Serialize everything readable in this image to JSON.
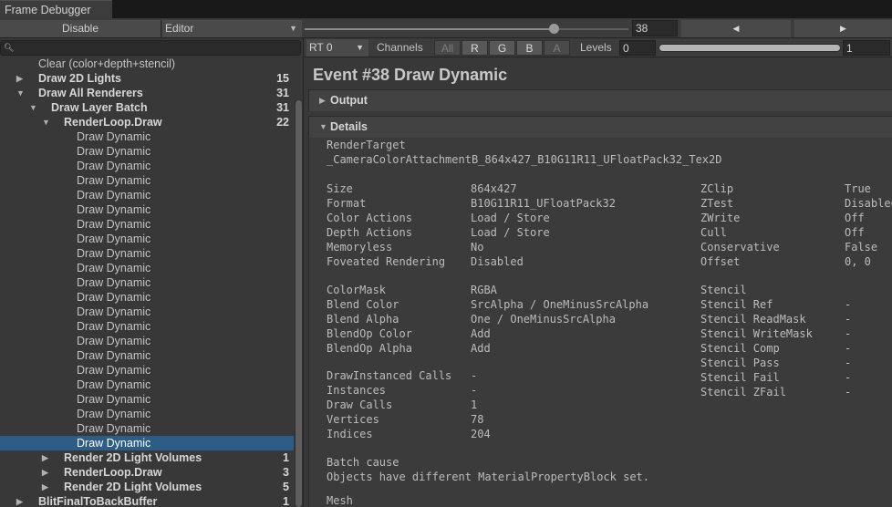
{
  "window": {
    "tab_title": "Frame Debugger"
  },
  "toolbar": {
    "disable_label": "Disable",
    "target_dropdown": "Editor",
    "event_index": "38",
    "slider_fraction": 0.77,
    "prev_icon": "triangle-left-icon",
    "next_icon": "triangle-right-icon"
  },
  "search": {
    "placeholder": "",
    "value": ""
  },
  "tree": [
    {
      "label": "Clear (color+depth+stencil)",
      "level": 0,
      "count": "",
      "bold": false,
      "arrow": "",
      "selected": false
    },
    {
      "label": "Draw 2D Lights",
      "level": 0,
      "count": "15",
      "bold": true,
      "arrow": "right",
      "selected": false
    },
    {
      "label": "Draw All Renderers",
      "level": 0,
      "count": "31",
      "bold": true,
      "arrow": "down",
      "selected": false
    },
    {
      "label": "Draw Layer Batch",
      "level": 1,
      "count": "31",
      "bold": true,
      "arrow": "down",
      "selected": false
    },
    {
      "label": "RenderLoop.Draw",
      "level": 2,
      "count": "22",
      "bold": true,
      "arrow": "down",
      "selected": false
    },
    {
      "label": "Draw Dynamic",
      "level": 3,
      "count": "",
      "bold": false,
      "arrow": "",
      "selected": false
    },
    {
      "label": "Draw Dynamic",
      "level": 3,
      "count": "",
      "bold": false,
      "arrow": "",
      "selected": false
    },
    {
      "label": "Draw Dynamic",
      "level": 3,
      "count": "",
      "bold": false,
      "arrow": "",
      "selected": false
    },
    {
      "label": "Draw Dynamic",
      "level": 3,
      "count": "",
      "bold": false,
      "arrow": "",
      "selected": false
    },
    {
      "label": "Draw Dynamic",
      "level": 3,
      "count": "",
      "bold": false,
      "arrow": "",
      "selected": false
    },
    {
      "label": "Draw Dynamic",
      "level": 3,
      "count": "",
      "bold": false,
      "arrow": "",
      "selected": false
    },
    {
      "label": "Draw Dynamic",
      "level": 3,
      "count": "",
      "bold": false,
      "arrow": "",
      "selected": false
    },
    {
      "label": "Draw Dynamic",
      "level": 3,
      "count": "",
      "bold": false,
      "arrow": "",
      "selected": false
    },
    {
      "label": "Draw Dynamic",
      "level": 3,
      "count": "",
      "bold": false,
      "arrow": "",
      "selected": false
    },
    {
      "label": "Draw Dynamic",
      "level": 3,
      "count": "",
      "bold": false,
      "arrow": "",
      "selected": false
    },
    {
      "label": "Draw Dynamic",
      "level": 3,
      "count": "",
      "bold": false,
      "arrow": "",
      "selected": false
    },
    {
      "label": "Draw Dynamic",
      "level": 3,
      "count": "",
      "bold": false,
      "arrow": "",
      "selected": false
    },
    {
      "label": "Draw Dynamic",
      "level": 3,
      "count": "",
      "bold": false,
      "arrow": "",
      "selected": false
    },
    {
      "label": "Draw Dynamic",
      "level": 3,
      "count": "",
      "bold": false,
      "arrow": "",
      "selected": false
    },
    {
      "label": "Draw Dynamic",
      "level": 3,
      "count": "",
      "bold": false,
      "arrow": "",
      "selected": false
    },
    {
      "label": "Draw Dynamic",
      "level": 3,
      "count": "",
      "bold": false,
      "arrow": "",
      "selected": false
    },
    {
      "label": "Draw Dynamic",
      "level": 3,
      "count": "",
      "bold": false,
      "arrow": "",
      "selected": false
    },
    {
      "label": "Draw Dynamic",
      "level": 3,
      "count": "",
      "bold": false,
      "arrow": "",
      "selected": false
    },
    {
      "label": "Draw Dynamic",
      "level": 3,
      "count": "",
      "bold": false,
      "arrow": "",
      "selected": false
    },
    {
      "label": "Draw Dynamic",
      "level": 3,
      "count": "",
      "bold": false,
      "arrow": "",
      "selected": false
    },
    {
      "label": "Draw Dynamic",
      "level": 3,
      "count": "",
      "bold": false,
      "arrow": "",
      "selected": false
    },
    {
      "label": "Draw Dynamic",
      "level": 3,
      "count": "",
      "bold": false,
      "arrow": "",
      "selected": true
    },
    {
      "label": "Render 2D Light Volumes",
      "level": 2,
      "count": "1",
      "bold": true,
      "arrow": "right",
      "selected": false
    },
    {
      "label": "RenderLoop.Draw",
      "level": 2,
      "count": "3",
      "bold": true,
      "arrow": "right",
      "selected": false
    },
    {
      "label": "Render 2D Light Volumes",
      "level": 2,
      "count": "5",
      "bold": true,
      "arrow": "right",
      "selected": false
    },
    {
      "label": "BlitFinalToBackBuffer",
      "level": 0,
      "count": "1",
      "bold": true,
      "arrow": "right",
      "selected": false
    }
  ],
  "rt_bar": {
    "rt_dropdown": "RT 0",
    "channels_label": "Channels",
    "channels": [
      {
        "label": "All",
        "active": false
      },
      {
        "label": "R",
        "active": true
      },
      {
        "label": "G",
        "active": true
      },
      {
        "label": "B",
        "active": true
      },
      {
        "label": "A",
        "active": false
      }
    ],
    "levels_label": "Levels",
    "levels_min": "0",
    "levels_max": "1"
  },
  "event": {
    "title": "Event #38 Draw Dynamic",
    "output_section": "Output",
    "details_section": "Details",
    "render_target_label": "RenderTarget",
    "render_target_value": "_CameraColorAttachmentB_864x427_B10G11R11_UFloatPack32_Tex2D",
    "left_group1": [
      {
        "key": "Size",
        "value": "864x427"
      },
      {
        "key": "Format",
        "value": "B10G11R11_UFloatPack32"
      },
      {
        "key": "Color Actions",
        "value": "Load / Store"
      },
      {
        "key": "Depth Actions",
        "value": "Load / Store"
      },
      {
        "key": "Memoryless",
        "value": "No"
      },
      {
        "key": "Foveated Rendering",
        "value": "Disabled"
      }
    ],
    "right_group1": [
      {
        "key": "ZClip",
        "value": "True"
      },
      {
        "key": "ZTest",
        "value": "Disabled"
      },
      {
        "key": "ZWrite",
        "value": "Off"
      },
      {
        "key": "Cull",
        "value": "Off"
      },
      {
        "key": "Conservative",
        "value": "False"
      },
      {
        "key": "Offset",
        "value": "0, 0"
      }
    ],
    "left_group2": [
      {
        "key": "ColorMask",
        "value": "RGBA"
      },
      {
        "key": "Blend Color",
        "value": "SrcAlpha / OneMinusSrcAlpha"
      },
      {
        "key": "Blend Alpha",
        "value": "One / OneMinusSrcAlpha"
      },
      {
        "key": "BlendOp Color",
        "value": "Add"
      },
      {
        "key": "BlendOp Alpha",
        "value": "Add"
      }
    ],
    "right_group2": [
      {
        "key": "Stencil",
        "value": ""
      },
      {
        "key": "Stencil Ref",
        "value": "-"
      },
      {
        "key": "Stencil ReadMask",
        "value": "-"
      },
      {
        "key": "Stencil WriteMask",
        "value": "-"
      },
      {
        "key": "Stencil Comp",
        "value": "-"
      },
      {
        "key": "Stencil Pass",
        "value": "-"
      },
      {
        "key": "Stencil Fail",
        "value": "-"
      },
      {
        "key": "Stencil ZFail",
        "value": "-"
      }
    ],
    "left_group3": [
      {
        "key": "DrawInstanced Calls",
        "value": "-"
      },
      {
        "key": "Instances",
        "value": "-"
      },
      {
        "key": "Draw Calls",
        "value": "1"
      },
      {
        "key": "Vertices",
        "value": "78"
      },
      {
        "key": "Indices",
        "value": "204"
      }
    ],
    "batch_cause_label": "Batch cause",
    "batch_cause_value": "Objects have different MaterialPropertyBlock set.",
    "mesh_label": "Mesh"
  },
  "colors": {
    "selection": "#2c5d87",
    "panel": "#383838",
    "field": "#2a2a2a"
  }
}
